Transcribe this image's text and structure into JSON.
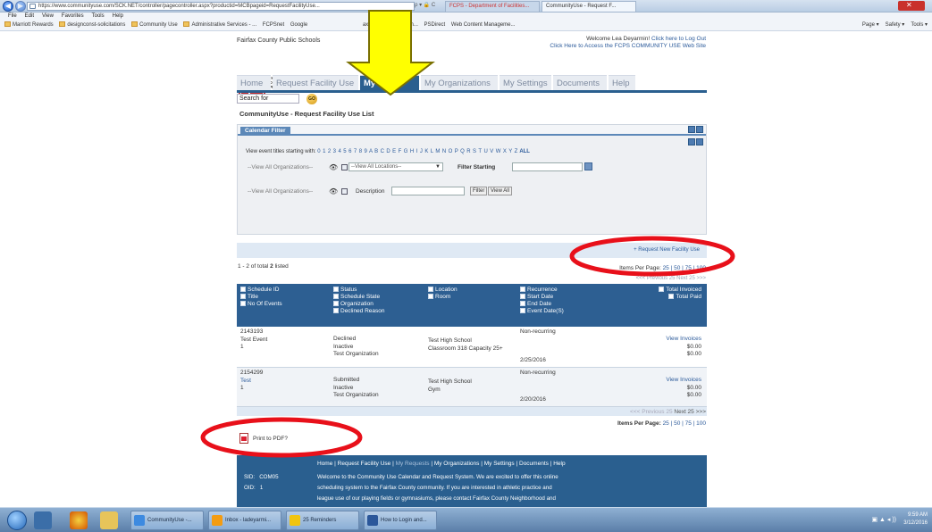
{
  "browser": {
    "url": "https://www.communityuse.com/SCK.NET/controller/pagecontroller.aspx?productid=MCBpageid=RequestFacilityUse...",
    "address_tools": "ρ ▾ 🔒 C",
    "tabs": [
      {
        "label": "FCPS - Department of Facilities..."
      },
      {
        "label": "CommunityUse - Request F..."
      }
    ],
    "menu": [
      "File",
      "Edit",
      "View",
      "Favorites",
      "Tools",
      "Help"
    ],
    "favorites": [
      "Marriott Rewards",
      "designconst-solicitations",
      "Community Use",
      "Administrative Services - ...",
      "FCPSnet",
      "Google",
      "ax County Public Sch...",
      "PSDirect",
      "Web Content Manageme..."
    ],
    "commands": [
      "Page ▾",
      "Safety ▾",
      "Tools ▾"
    ]
  },
  "site": {
    "name": "Fairfax County Public Schools",
    "welcome_line": "Welcome Lea Deyarmin!",
    "logout": "Click here to Log Out",
    "access_line": "Click Here to Access the FCPS COMMUNITY USE Web Site",
    "logo_text": [
      "FAIRFAX",
      "COUNTY",
      "PUBLIC",
      "SCHOOLS"
    ],
    "logo_letters": [
      "FC",
      "PS"
    ]
  },
  "nav": {
    "tabs": [
      "Home",
      "Request Facility Use",
      "My Requests",
      "My Organizations",
      "My Settings",
      "Documents",
      "Help"
    ],
    "active": "My Requests"
  },
  "search": {
    "label": "Search for",
    "go": "GO"
  },
  "breadcrumb": "CommunityUse - Request Facility Use List",
  "filter": {
    "tab": "Calendar Filter",
    "alpha_label": "View event titles starting with:",
    "letters": "0 1 2 3 4 5 6 7 8 9 A B C D E F G H I J K L M N O P Q R S T U V W X Y Z",
    "all": "ALL",
    "org_select": "--View All Organizations--",
    "loc_select": "--View All Locations--",
    "filter_starting": "Filter Starting",
    "org_select2": "--View All Organizations--",
    "description": "Description",
    "filter_btn": "Filter",
    "view_all_btn": "View All"
  },
  "request_new": "+ Request New Facility Use",
  "list": {
    "count_text": "1 - 2 of total",
    "total": "2",
    "listed": "listed",
    "ipp_label": "Items Per Page:",
    "ipp_options": "25 | 50 | 75 | 100",
    "prevnext": "<<< Previous 25  Next 25 >>>",
    "prev": "<<< Previous 25",
    "next": "Next 25 >>>"
  },
  "grid": {
    "headers": {
      "c1": [
        "Schedule ID",
        "Title",
        "No Of Events"
      ],
      "c2": [
        "Status",
        "Schedule State",
        "Organization",
        "Declined Reason"
      ],
      "c3": [
        "Location",
        "Room"
      ],
      "c4": [
        "Recurrence",
        "Start Date",
        "End Date",
        "Event Date(S)"
      ],
      "c5": [
        "Total Invoiced",
        "Total Paid"
      ]
    },
    "rows": [
      {
        "id": "2143193",
        "title": "Test Event",
        "events": "1",
        "status": "Declined",
        "state": "Inactive",
        "org": "Test Organization",
        "location": "Test High School",
        "room": "Classroom 318 Capacity 25+",
        "recurrence": "Non-recurring",
        "date": "2/25/2016",
        "invoice_link": "View Invoices",
        "invoiced": "$0.00",
        "paid": "$0.00"
      },
      {
        "id": "2154299",
        "title": "Test",
        "events": "1",
        "status": "Submitted",
        "state": "Inactive",
        "org": "Test Organization",
        "location": "Test High School",
        "room": "Gym",
        "recurrence": "Non-recurring",
        "date": "2/20/2016",
        "invoice_link": "View Invoices",
        "invoiced": "$0.00",
        "paid": "$0.00"
      }
    ]
  },
  "print_pdf": "Print to PDF?",
  "footer": {
    "links": [
      "Home",
      "Request Facility Use",
      "My Requests",
      "My Organizations",
      "My Settings",
      "Documents",
      "Help"
    ],
    "sid_label": "SID:",
    "sid": "COM05",
    "oid_label": "OID:",
    "oid": "1",
    "text_lines": [
      "Welcome to the Community Use Calendar and Request System. We are excited to offer this online",
      "scheduling system to the Fairfax County community. If you are interested in athletic practice and",
      "league use of our playing fields or gymnasiums, please contact Fairfax County Neighborhood and"
    ]
  },
  "taskbar": {
    "tasks": [
      "CommunityUse -...",
      "Inbox - ladeyarmi...",
      "25 Reminders",
      "How to Login and..."
    ],
    "time": "9:59 AM",
    "date": "3/12/2016"
  },
  "colors": {
    "nav_blue": "#2a5f8f",
    "arrow_yellow": "#ffff00",
    "annotation_red": "#e8101a"
  }
}
